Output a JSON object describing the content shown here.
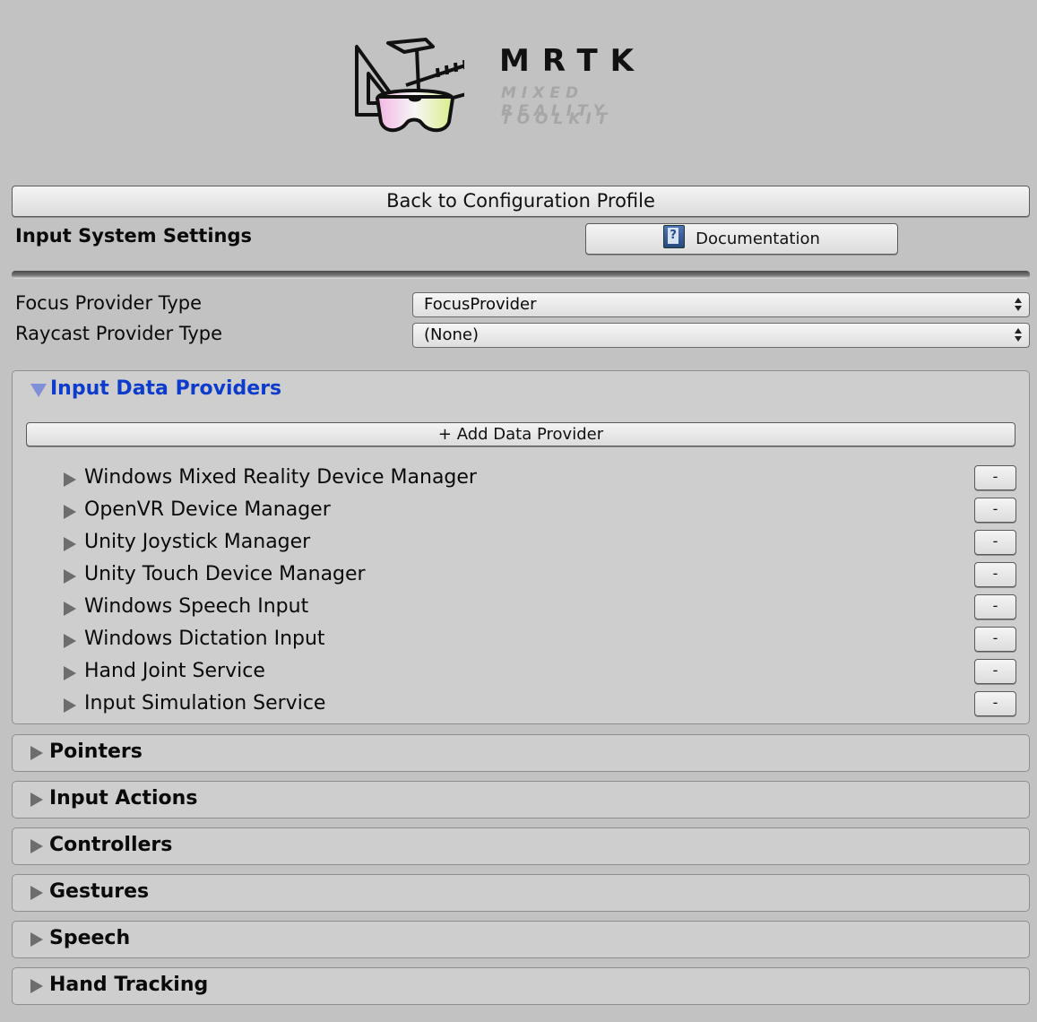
{
  "logo": {
    "title": "MRTK",
    "subtitle_line1": "MIXED REALITY",
    "subtitle_line2": "TOOLKIT"
  },
  "header": {
    "back_label": "Back to Configuration Profile",
    "section_title": "Input System Settings",
    "doc_label": "Documentation"
  },
  "fields": {
    "focus_label": "Focus Provider Type",
    "focus_value": "FocusProvider",
    "raycast_label": "Raycast Provider Type",
    "raycast_value": "(None)"
  },
  "providers": {
    "title": "Input Data Providers",
    "add_label": "+ Add Data Provider",
    "remove_label": "-",
    "items": [
      "Windows Mixed Reality Device Manager",
      "OpenVR Device Manager",
      "Unity Joystick Manager",
      "Unity Touch Device Manager",
      "Windows Speech Input",
      "Windows Dictation Input",
      "Hand Joint Service",
      "Input Simulation Service"
    ]
  },
  "sections": [
    "Pointers",
    "Input Actions",
    "Controllers",
    "Gestures",
    "Speech",
    "Hand Tracking"
  ],
  "colors": {
    "background": "#c2c2c2",
    "foldout_active": "#0d3ccc",
    "panel": "#cecece"
  }
}
